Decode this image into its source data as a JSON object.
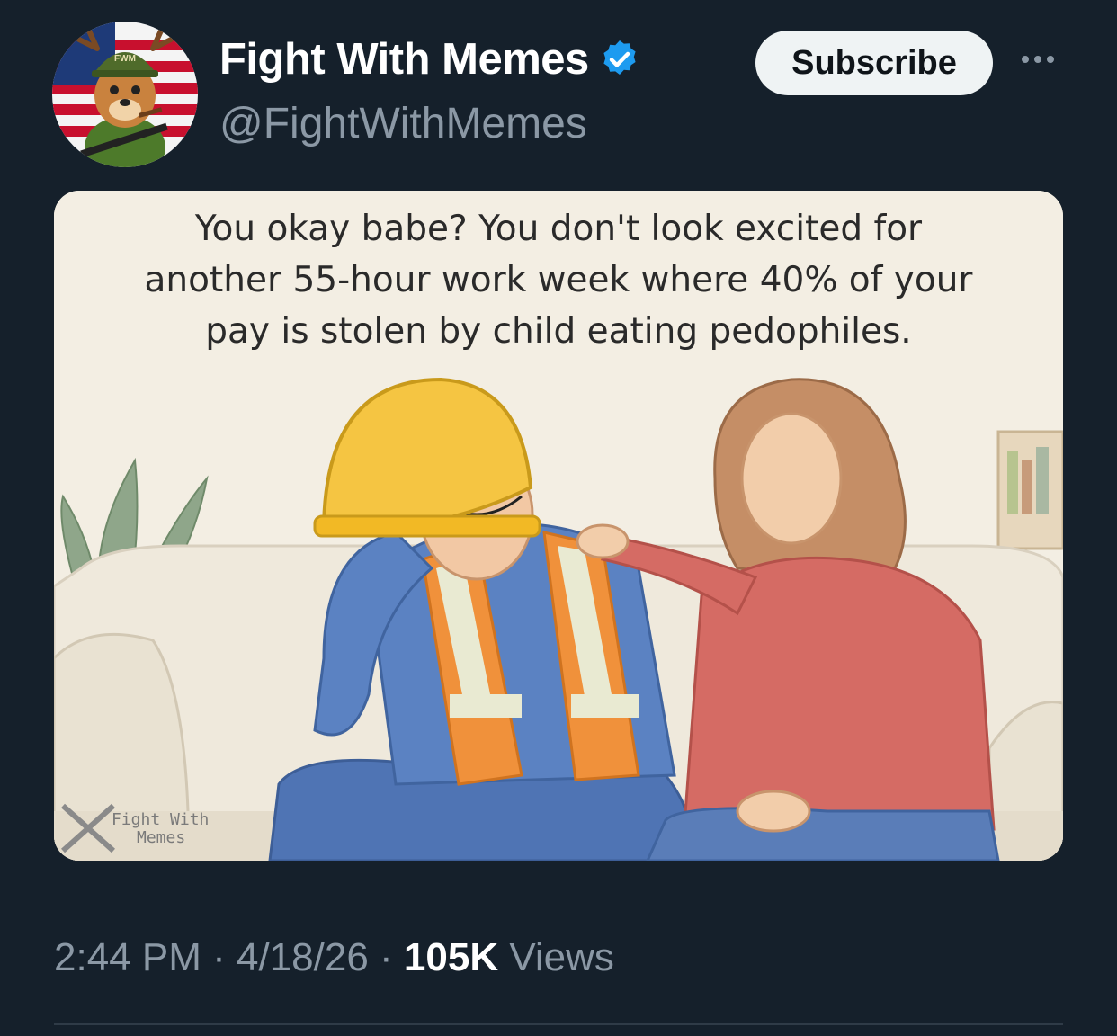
{
  "author": {
    "display_name": "Fight With Memes",
    "handle": "@FightWithMemes",
    "avatar_badge": "FWM",
    "verified": true,
    "verified_color": "#1d9bf0"
  },
  "actions": {
    "subscribe_label": "Subscribe",
    "more_icon": "more-horizontal-icon"
  },
  "media": {
    "caption_lines": [
      "You okay babe? You don't look excited for",
      "another 55-hour work week where 40% of your",
      "pay is stolen by child eating pedophiles."
    ],
    "watermark_line1": "Fight With",
    "watermark_line2": "Memes"
  },
  "meta": {
    "time": "2:44 PM",
    "separator": " · ",
    "date": "4/18/26",
    "views_count": "105K",
    "views_label": " Views"
  },
  "colors": {
    "background": "#15202b",
    "muted_text": "#8b98a5",
    "button_bg": "#eff3f4"
  }
}
